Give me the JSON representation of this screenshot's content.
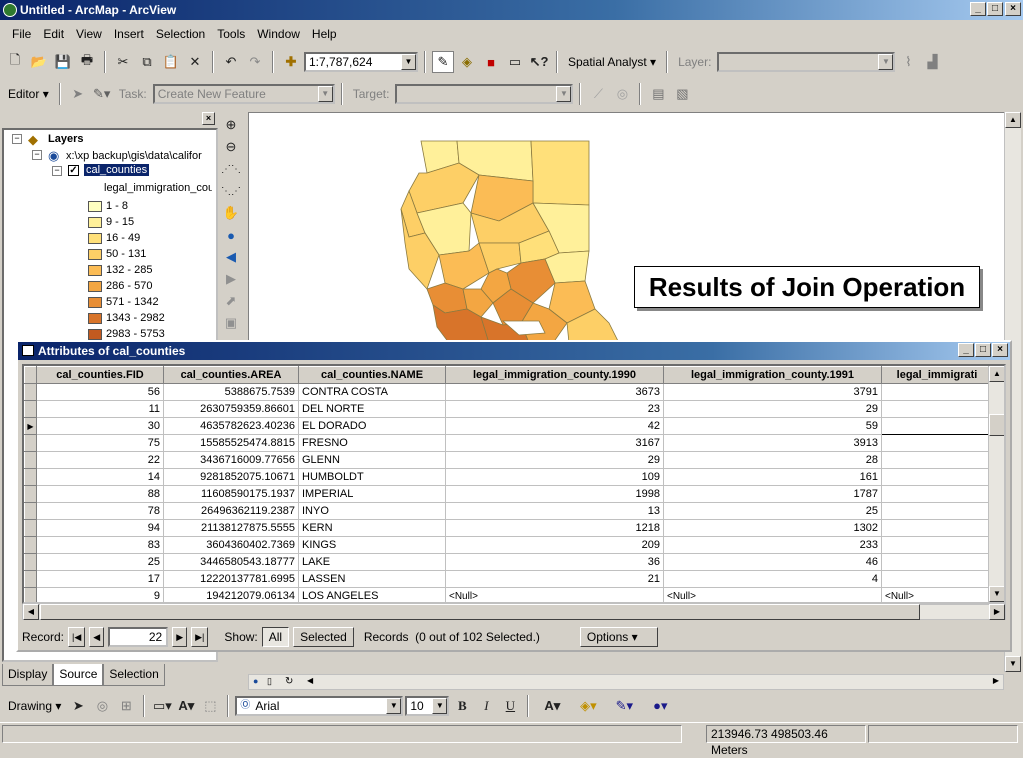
{
  "window": {
    "title": "Untitled - ArcMap - ArcView",
    "min": "_",
    "max": "□",
    "close": "×"
  },
  "menu": [
    "File",
    "Edit",
    "View",
    "Insert",
    "Selection",
    "Tools",
    "Window",
    "Help"
  ],
  "toolbar": {
    "scale": "1:7,787,624",
    "spatial_analyst": "Spatial Analyst",
    "layer_label": "Layer:"
  },
  "editor": {
    "editor_label": "Editor",
    "task_label": "Task:",
    "task_value": "Create New Feature",
    "target_label": "Target:"
  },
  "toc": {
    "layers_label": "Layers",
    "path": "x:\\xp backup\\gis\\data\\califor",
    "layer": "cal_counties",
    "field": "legal_immigration_cou",
    "classes": [
      {
        "label": "1 - 8",
        "color": "#ffffc0"
      },
      {
        "label": "9 - 15",
        "color": "#fff09a"
      },
      {
        "label": "16 - 49",
        "color": "#ffe07a"
      },
      {
        "label": "50 - 131",
        "color": "#fdcf66"
      },
      {
        "label": "132 - 285",
        "color": "#fbbc55"
      },
      {
        "label": "286 - 570",
        "color": "#f3a642"
      },
      {
        "label": "571 - 1342",
        "color": "#e88e35"
      },
      {
        "label": "1343 - 2982",
        "color": "#d8742a"
      },
      {
        "label": "2983 - 5753",
        "color": "#c25a20"
      }
    ],
    "tabs": [
      "Display",
      "Source",
      "Selection"
    ]
  },
  "map": {
    "callout": "Results of Join Operation"
  },
  "attributes": {
    "title": "Attributes of cal_counties",
    "columns": [
      "cal_counties.FID",
      "cal_counties.AREA",
      "cal_counties.NAME",
      "legal_immigration_county.1990",
      "legal_immigration_county.1991",
      "legal_immigrati"
    ],
    "rows": [
      [
        "56",
        "5388675.7539",
        "CONTRA COSTA",
        "3673",
        "3791",
        ""
      ],
      [
        "11",
        "2630759359.86601",
        "DEL NORTE",
        "23",
        "29",
        ""
      ],
      [
        "30",
        "4635782623.40236",
        "EL DORADO",
        "42",
        "59",
        ""
      ],
      [
        "75",
        "15585525474.8815",
        "FRESNO",
        "3167",
        "3913",
        ""
      ],
      [
        "22",
        "3436716009.77656",
        "GLENN",
        "29",
        "28",
        ""
      ],
      [
        "14",
        "9281852075.10671",
        "HUMBOLDT",
        "109",
        "161",
        ""
      ],
      [
        "88",
        "11608590175.1937",
        "IMPERIAL",
        "1998",
        "1787",
        ""
      ],
      [
        "78",
        "26496362119.2387",
        "INYO",
        "13",
        "25",
        ""
      ],
      [
        "94",
        "21138127875.5555",
        "KERN",
        "1218",
        "1302",
        ""
      ],
      [
        "83",
        "3604360402.7369",
        "KINGS",
        "209",
        "233",
        ""
      ],
      [
        "25",
        "3446580543.18777",
        "LAKE",
        "36",
        "46",
        ""
      ],
      [
        "17",
        "12220137781.6995",
        "LASSEN",
        "21",
        "4",
        ""
      ],
      [
        "9",
        "194212079.06134",
        "LOS ANGELES",
        "<Null>",
        "<Null>",
        "<Null>"
      ]
    ],
    "record_label": "Record:",
    "record_value": "22",
    "show_label": "Show:",
    "all_label": "All",
    "selected_label": "Selected",
    "records_text": "Records  (0 out of 102 Selected.)",
    "options_label": "Options"
  },
  "drawing": {
    "drawing_label": "Drawing",
    "font": "Arial",
    "size": "10"
  },
  "status": {
    "coords": "213946.73  498503.46 Meters"
  }
}
